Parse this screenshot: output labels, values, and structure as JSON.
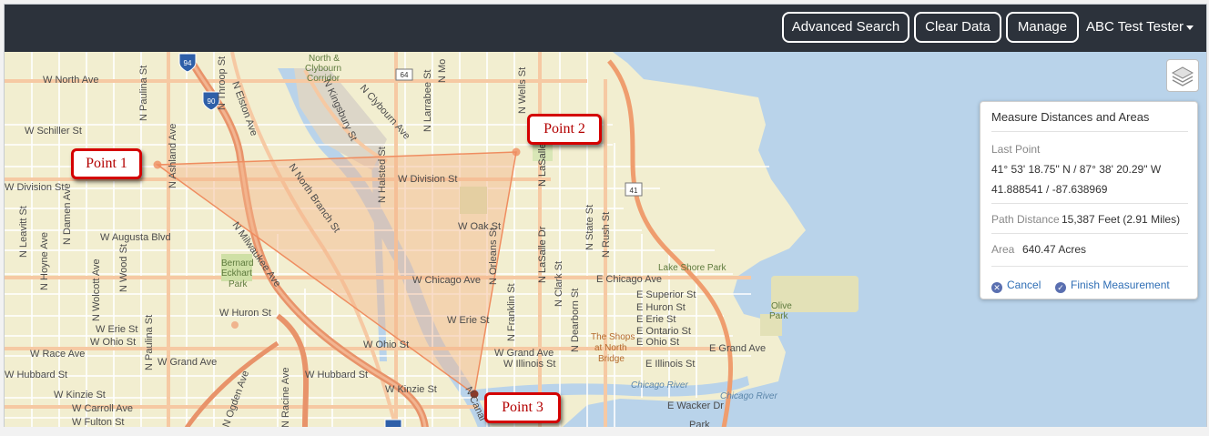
{
  "navbar": {
    "advanced_search": "Advanced Search",
    "clear_data": "Clear Data",
    "manage": "Manage",
    "user": "ABC Test Tester"
  },
  "callouts": {
    "point1": "Point 1",
    "point2": "Point 2",
    "point3": "Point 3"
  },
  "measure_panel": {
    "title": "Measure Distances and Areas",
    "last_point_label": "Last Point",
    "last_point_dms": "41° 53' 18.75\" N / 87° 38' 20.29\" W",
    "last_point_decimal": "41.888541 / -87.638969",
    "path_distance_label": "Path Distance",
    "path_distance_value": "15,387 Feet (2.91 Miles)",
    "area_label": "Area",
    "area_value": "640.47 Acres",
    "cancel": "Cancel",
    "finish": "Finish Measurement"
  },
  "map_labels": {
    "streets": {
      "north_ave": "W North Ave",
      "schiller": "W Schiller St",
      "division_w": "W Division St",
      "division_mid": "W Division St",
      "augusta": "W Augusta Blvd",
      "chicago": "W Chicago Ave",
      "chicago_e": "E Chicago Ave",
      "huron": "W Huron St",
      "erie_w": "W Erie St",
      "erie_mid": "W Erie St",
      "ohio_w": "W Ohio St",
      "ohio_mid": "W Ohio St",
      "race": "W Race Ave",
      "grand": "W Grand Ave",
      "grand_e": "E Grand Ave",
      "hubbard_w": "W Hubbard St",
      "hubbard_mid": "W Hubbard St",
      "kinzie_w": "W Kinzie St",
      "kinzie_mid": "W Kinzie St",
      "carroll": "W Carroll Ave",
      "fulton": "W Fulton St",
      "oak": "W Oak St",
      "illinois_w": "W Illinois St",
      "illinois_e": "E Illinois St",
      "superior_e": "E Superior St",
      "huron_e": "E Huron St",
      "erie_e": "E Erie St",
      "ontario_e": "E Ontario St",
      "ohio_e": "E Ohio St",
      "wacker_e": "E Wacker Dr",
      "leavitt": "N Leavitt St",
      "hoyne": "N Hoyne Ave",
      "damen": "N Damen Ave",
      "wolcott": "N Wolcott Ave",
      "wood": "N Wood St",
      "paulina_n": "N Paulina St",
      "paulina_s": "N Paulina St",
      "ashland": "N Ashland Ave",
      "throop": "N Throop St",
      "elston": "N Elston Ave",
      "milwaukee": "N Milwaukee Ave",
      "north_branch": "N North Branch St",
      "kingsbury": "N Kingsbury St",
      "clybourn": "N Clybourn Ave",
      "halsted": "N Halsted St",
      "larrabee": "N Larrabee St",
      "orleans": "N Orleans St",
      "franklin": "N Franklin St",
      "wells": "N Wells St",
      "lasalle_dr": "N LaSalle Dr",
      "lasalle": "N LaSalle St",
      "clark": "N Clark St",
      "dearborn": "N Dearborn St",
      "state": "N State St",
      "rush": "N Rush St",
      "ogden": "N Ogden Ave",
      "racine": "N Racine Ave",
      "canal": "N Canal",
      "mo": "N Mo",
      "sheldon_ave": "Ogden Ave",
      "lake_shore_park": "Lake Shore Park",
      "chicago_river": "Chicago River",
      "chicago_river2": "Chicago River",
      "the_shops": "The Shops",
      "at_north": "at North",
      "bridge": "Bridge",
      "park": "Park",
      "bernard": "Bernard",
      "eckhart": "Eckhart",
      "park2": "Park",
      "olive": "Olive",
      "park3": "Park",
      "north_clybourn": "North &",
      "clybourn_lbl": "Clybourn",
      "corridor": "Corridor",
      "ogden_sm": "ge Ave"
    },
    "shields": {
      "i94": "94",
      "i90": "90",
      "r64": "64",
      "r41": "41",
      "i90b": "90"
    }
  },
  "colors": {
    "navbar": "#2c323b",
    "water": "#b9d3ea",
    "land": "#f2eed0",
    "measure_fill": "#f3b48a",
    "measure_line": "#ef8d60",
    "callout_border": "#d40000"
  },
  "icons": {
    "layers": "layers-icon",
    "cancel": "cancel-icon",
    "finish": "check-icon",
    "caret": "caret-down-icon"
  }
}
